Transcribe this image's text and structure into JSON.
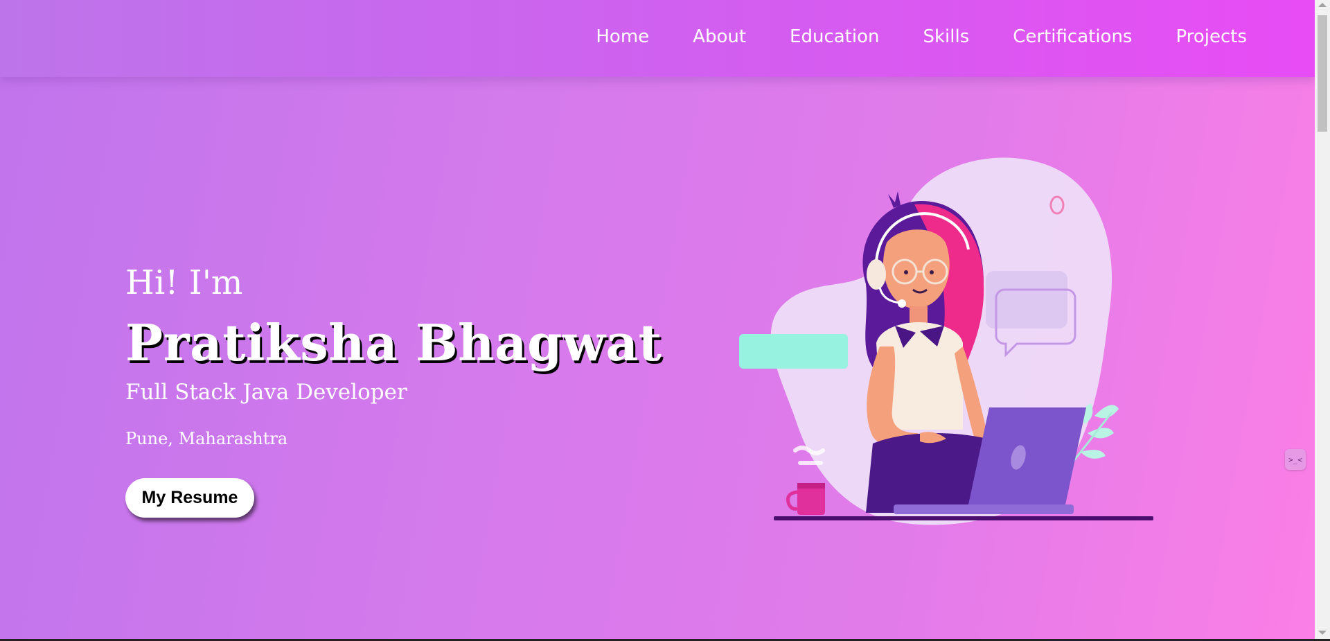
{
  "nav": {
    "links": [
      "Home",
      "About",
      "Education",
      "Skills",
      "Certifications",
      "Projects"
    ]
  },
  "hero": {
    "greeting": "Hi! I'm",
    "name": "Pratiksha Bhagwat",
    "role": "Full Stack Java Developer",
    "location": "Pune, Maharashtra",
    "resume_button": "My Resume"
  },
  "widget": {
    "icon": "robot-face-icon",
    "glyph": ">_<"
  },
  "colors": {
    "nav_start": "#bd74ea",
    "nav_end": "#e84cf4",
    "bg_start": "#c074ec",
    "bg_end": "#fb7fe6",
    "text": "#ffffff"
  }
}
